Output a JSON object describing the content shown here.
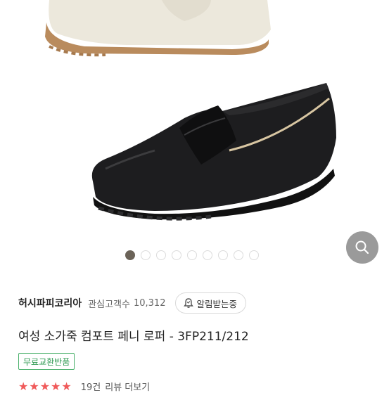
{
  "gallery": {
    "slide_count": 9,
    "active_index": 0
  },
  "icons": {
    "search": "search-icon",
    "bell": "bell-icon",
    "star": "star-icon"
  },
  "colors": {
    "badge_green": "#49b06a",
    "star_red": "#f05a5a",
    "dot_active": "#6b6358",
    "fab_gray": "#9a9a9a"
  },
  "seller": {
    "name": "허시파피코리아",
    "favorite_label": "관심고객수",
    "favorite_count": "10,312",
    "alarm_label": "알림받는중"
  },
  "product": {
    "title": "여성 소가죽 컴포트 페니 로퍼 - 3FP211/212",
    "badge": "무료교환반품"
  },
  "rating": {
    "stars": "★★★★★",
    "review_count": "19건",
    "review_link": "리뷰 더보기"
  }
}
